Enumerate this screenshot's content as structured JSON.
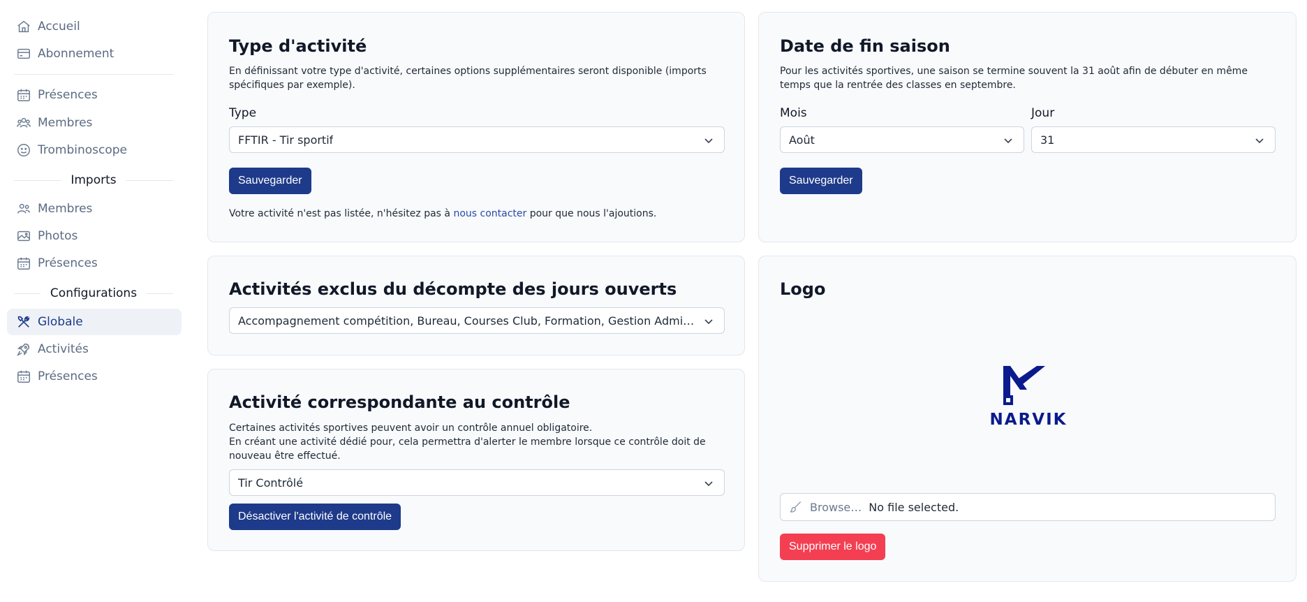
{
  "sidebar": {
    "items_top": [
      {
        "label": "Accueil",
        "icon": "home-icon"
      },
      {
        "label": "Abonnement",
        "icon": "card-icon"
      }
    ],
    "items_main": [
      {
        "label": "Présences",
        "icon": "calendar-icon"
      },
      {
        "label": "Membres",
        "icon": "users-icon"
      },
      {
        "label": "Trombinoscope",
        "icon": "smiley-icon"
      }
    ],
    "imports_title": "Imports",
    "items_imports": [
      {
        "label": "Membres",
        "icon": "users-icon"
      },
      {
        "label": "Photos",
        "icon": "image-icon"
      },
      {
        "label": "Présences",
        "icon": "calendar-icon"
      }
    ],
    "config_title": "Configurations",
    "items_config": [
      {
        "label": "Globale",
        "icon": "tools-icon",
        "active": true
      },
      {
        "label": "Activités",
        "icon": "rocket-icon"
      },
      {
        "label": "Présences",
        "icon": "calendar-icon"
      }
    ]
  },
  "type_card": {
    "title": "Type d'activité",
    "description": "En définissant votre type d'activité, certaines options supplémentaires seront disponible (imports spécifiques par exemple).",
    "type_label": "Type",
    "type_value": "FFTIR - Tir sportif",
    "save_label": "Sauvegarder",
    "note_before": "Votre activité n'est pas listée, n'hésitez pas à ",
    "note_link": "nous contacter",
    "note_after": " pour que nous l'ajoutions."
  },
  "season_card": {
    "title": "Date de fin saison",
    "description": "Pour les activités sportives, une saison se termine souvent la 31 août afin de débuter en même temps que la rentrée des classes en septembre.",
    "month_label": "Mois",
    "month_value": "Août",
    "day_label": "Jour",
    "day_value": "31",
    "save_label": "Sauvegarder"
  },
  "excluded_card": {
    "title": "Activités exclus du décompte des jours ouverts",
    "value": "Accompagnement compétition, Bureau, Courses Club, Formation, Gestion Administrative"
  },
  "control_card": {
    "title": "Activité correspondante au contrôle",
    "description_1": "Certaines activités sportives peuvent avoir un contrôle annuel obligatoire.",
    "description_2": "En créant une activité dédié pour, cela permettra d'alerter le membre lorsque ce contrôle doit de nouveau être effectué.",
    "value": "Tir Contrôlé",
    "disable_label": "Désactiver l'activité de contrôle"
  },
  "logo_card": {
    "title": "Logo",
    "logo_text": "NARVIK",
    "browse_label": "Browse…",
    "file_status": "No file selected.",
    "delete_label": "Supprimer le logo"
  },
  "colors": {
    "primary": "#1e3a8a",
    "danger": "#f43f52",
    "logo": "#0b1a8c"
  }
}
